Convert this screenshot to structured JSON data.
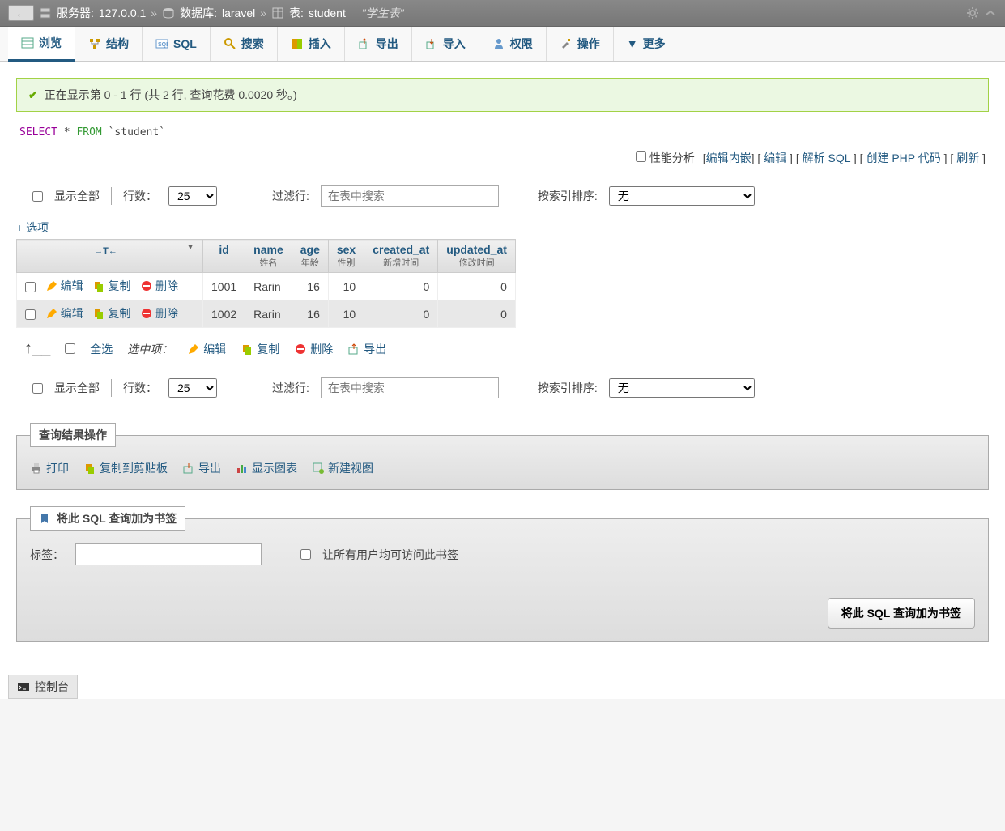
{
  "topbar": {
    "server_label": "服务器:",
    "server": "127.0.0.1",
    "db_label": "数据库:",
    "db": "laravel",
    "table_label": "表:",
    "table": "student",
    "comment": "\"学生表\""
  },
  "tabs": {
    "browse": "浏览",
    "structure": "结构",
    "sql": "SQL",
    "search": "搜索",
    "insert": "插入",
    "export": "导出",
    "import": "导入",
    "privileges": "权限",
    "operations": "操作",
    "more": "更多"
  },
  "success_msg": "正在显示第 0 - 1 行 (共 2 行, 查询花费 0.0020 秒。)",
  "sql_query": {
    "select": "SELECT",
    "star": " * ",
    "from": "FROM",
    "table": " `student`"
  },
  "links": {
    "profiling": "性能分析",
    "edit_inline": "编辑内嵌",
    "edit": "编辑",
    "explain": "解析 SQL",
    "php": "创建 PHP 代码",
    "refresh": "刷新"
  },
  "controls": {
    "show_all": "显示全部",
    "rows_label": "行数：",
    "rows_value": "25",
    "filter_label": "过滤行:",
    "filter_placeholder": "在表中搜索",
    "sort_label": "按索引排序:",
    "sort_value": "无"
  },
  "options_link": "+ 选项",
  "columns": {
    "id": {
      "name": "id",
      "sub": ""
    },
    "name": {
      "name": "name",
      "sub": "姓名"
    },
    "age": {
      "name": "age",
      "sub": "年龄"
    },
    "sex": {
      "name": "sex",
      "sub": "性别"
    },
    "created_at": {
      "name": "created_at",
      "sub": "新增时间"
    },
    "updated_at": {
      "name": "updated_at",
      "sub": "修改时间"
    }
  },
  "actions": {
    "edit": "编辑",
    "copy": "复制",
    "delete": "删除"
  },
  "rows": [
    {
      "id": "1001",
      "name": "Rarin",
      "age": "16",
      "sex": "10",
      "created_at": "0",
      "updated_at": "0"
    },
    {
      "id": "1002",
      "name": "Rarin",
      "age": "16",
      "sex": "10",
      "created_at": "0",
      "updated_at": "0"
    }
  ],
  "bulk": {
    "check_all": "全选",
    "with_selected": "选中项：",
    "edit": "编辑",
    "copy": "复制",
    "delete": "删除",
    "export": "导出"
  },
  "result_ops": {
    "legend": "查询结果操作",
    "print": "打印",
    "clipboard": "复制到剪贴板",
    "export": "导出",
    "chart": "显示图表",
    "view": "新建视图"
  },
  "bookmark": {
    "legend": "将此 SQL 查询加为书签",
    "label": "标签：",
    "share": "让所有用户均可访问此书签",
    "button": "将此 SQL 查询加为书签"
  },
  "console": "控制台"
}
